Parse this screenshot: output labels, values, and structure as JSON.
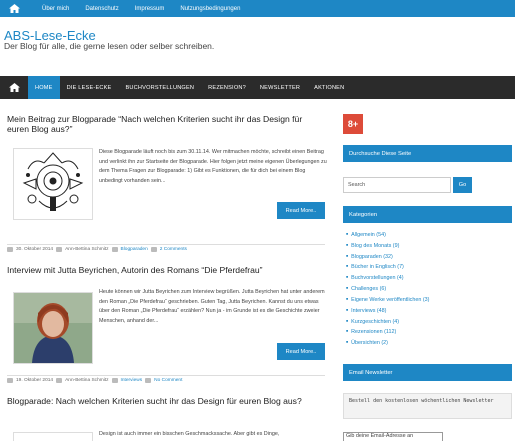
{
  "topbar": {
    "items": [
      "Über mich",
      "Datenschutz",
      "Impressum",
      "Nutzungsbedingungen"
    ]
  },
  "site": {
    "title": "ABS-Lese-Ecke",
    "description": "Der Blog für alle, die gerne lesen oder selber schreiben."
  },
  "nav": {
    "items": [
      "HOME",
      "DIE LESE-ECKE",
      "BUCHVORSTELLUNGEN",
      "REZENSION?",
      "NEWSLETTER",
      "AKTIONEN"
    ]
  },
  "posts": [
    {
      "title": "Mein Beitrag zur Blogparade “Nach welchen Kriterien sucht ihr das Design für euren Blog aus?”",
      "excerpt": "Diese Blogparade läuft noch bis zum 30.11.14. Wer mitmachen möchte, schreibt einen Beitrag und verlinkt ihn zur Startseite der Blogparade. Hier folgen jetzt meine eigenen Überlegungen zu dem Thema Fragen zur Blogparade: 1) Gibt es Funktionen, die für dich bei einem Blog unbedingt vorhanden sein...",
      "read_more": "Read More..",
      "date": "30. Oktober 2014",
      "author": "Ann-Bettina Schmitz",
      "category": "Blogparaden",
      "comments": "2 Comments"
    },
    {
      "title": "Interview mit Jutta Beyrichen, Autorin des Romans “Die Pferdefrau”",
      "excerpt": "Heute können wir Jutta Beyrichen zum Interview begrüßen. Jutta Beyrichen hat unter anderem den Roman „Die Pferdefrau“ geschrieben. Guten Tag, Jutta Beyrichen. Kannst du uns etwas über den Roman „Die Pferdefrau“ erzählen? Nun ja - im Grunde ist es die Geschichte zweier Menschen, anhand der...",
      "read_more": "Read More..",
      "date": "19. Oktober 2014",
      "author": "Ann-Bettina Schmitz",
      "category": "Interviews",
      "comments": "No Comment"
    },
    {
      "title": "Blogparade: Nach welchen Kriterien sucht ihr das Design für euren Blog aus?",
      "excerpt": "Design ist auch immer ein bisschen Geschmackssache. Aber gibt es Dinge,"
    }
  ],
  "sidebar": {
    "gplus": "8+",
    "search_title": "Durchsuche Diese Seite",
    "search_placeholder": "Search",
    "search_button": "Go",
    "categories_title": "Kategorien",
    "categories": [
      "Allgemein (54)",
      "Blog des Monats (9)",
      "Blogparaden (32)",
      "Bücher in Englisch (7)",
      "Buchvorstellungen (4)",
      "Challenges (6)",
      "Eigene Werke veröffentlichen (3)",
      "Interviews (48)",
      "Kurzgeschichten (4)",
      "Rezensionen (112)",
      "Übersichten (2)"
    ],
    "newsletter_title": "Email Newsletter",
    "newsletter_text": "Bestell den kostenlosen wöchentlichen Newsletter",
    "email_placeholder": "Gib deine Email-Adresse an"
  },
  "colors": {
    "accent": "#1e87c5",
    "nav_bg": "#2b2b2b",
    "gplus": "#dd4b39"
  }
}
